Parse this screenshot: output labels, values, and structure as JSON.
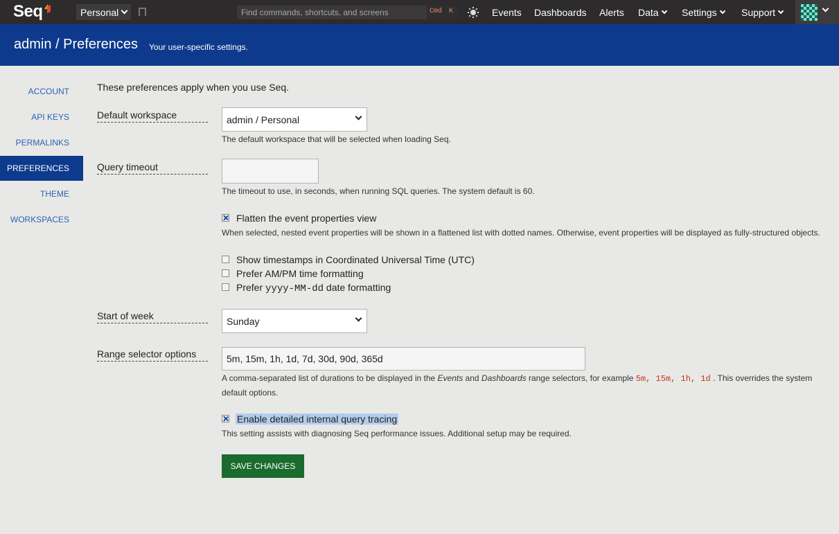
{
  "app": {
    "logo_text": "Seq",
    "workspace": "Personal",
    "search_placeholder": "Find commands, shortcuts, and screens",
    "shortcut_keys": [
      "Cmd",
      "K"
    ]
  },
  "nav": [
    {
      "label": "Events",
      "dropdown": false
    },
    {
      "label": "Dashboards",
      "dropdown": false
    },
    {
      "label": "Alerts",
      "dropdown": false
    },
    {
      "label": "Data",
      "dropdown": true
    },
    {
      "label": "Settings",
      "dropdown": true
    },
    {
      "label": "Support",
      "dropdown": true
    }
  ],
  "header": {
    "title": "admin / Preferences",
    "subtitle": "Your user-specific settings."
  },
  "sidebar": {
    "items": [
      {
        "label": "Account",
        "active": false
      },
      {
        "label": "API Keys",
        "active": false
      },
      {
        "label": "Permalinks",
        "active": false
      },
      {
        "label": "Preferences",
        "active": true
      },
      {
        "label": "Theme",
        "active": false
      },
      {
        "label": "Workspaces",
        "active": false
      }
    ]
  },
  "main": {
    "intro": "These preferences apply when you use Seq.",
    "default_workspace": {
      "label": "Default workspace",
      "value": "admin / Personal",
      "help": "The default workspace that will be selected when loading Seq."
    },
    "query_timeout": {
      "label": "Query timeout",
      "value": "",
      "help": "The timeout to use, in seconds, when running SQL queries. The system default is 60."
    },
    "flatten": {
      "label": "Flatten the event properties view",
      "checked": true,
      "help": "When selected, nested event properties will be shown in a flattened list with dotted names. Otherwise, event properties will be displayed as fully-structured objects."
    },
    "utc": {
      "label": "Show timestamps in Coordinated Universal Time (UTC)",
      "checked": false
    },
    "ampm": {
      "label": "Prefer AM/PM time formatting",
      "checked": false
    },
    "date_format": {
      "label_prefix": "Prefer ",
      "label_code": "yyyy-MM-dd",
      "label_suffix": " date formatting",
      "checked": false
    },
    "start_of_week": {
      "label": "Start of week",
      "value": "Sunday"
    },
    "range_selector": {
      "label": "Range selector options",
      "value": "5m, 15m, 1h, 1d, 7d, 30d, 90d, 365d",
      "help_1": "A comma-separated list of durations to be displayed in the ",
      "help_events": "Events",
      "help_and": " and ",
      "help_dashboards": "Dashboards",
      "help_2": " range selectors, for example ",
      "help_example": "5m, 15m, 1h, 1d",
      "help_3": ". This overrides the system default options."
    },
    "tracing": {
      "label": "Enable detailed internal query tracing",
      "checked": true,
      "help": "This setting assists with diagnosing Seq performance issues. Additional setup may be required."
    },
    "save_label": "Save Changes"
  },
  "colors": {
    "topbar": "#2d2b2c",
    "brand_blue": "#0d3a8c",
    "link_blue": "#2b63b5",
    "save_green": "#1a6b2e",
    "code_red": "#c0391b"
  }
}
